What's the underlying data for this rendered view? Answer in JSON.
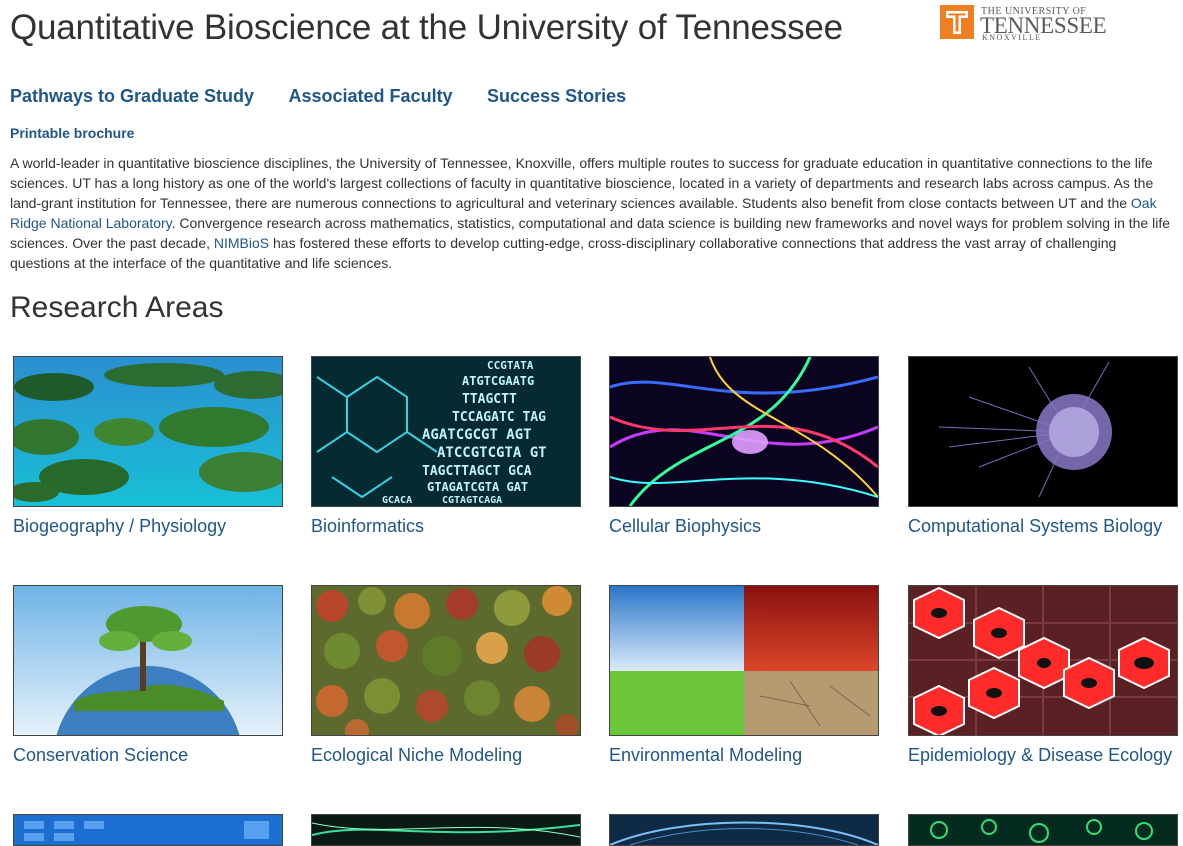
{
  "title": "Quantitative Bioscience at the University of Tennessee",
  "logo": {
    "line1": "THE UNIVERSITY OF",
    "line2": "TENNESSEE",
    "line3": "KNOXVILLE"
  },
  "nav": [
    {
      "label": "Pathways to Graduate Study"
    },
    {
      "label": "Associated Faculty"
    },
    {
      "label": "Success Stories"
    }
  ],
  "brochure_label": "Printable brochure",
  "intro": {
    "part1": "A world-leader in quantitative bioscience disciplines, the University of Tennessee, Knoxville, offers multiple routes to success for graduate education in quantitative connections to the life sciences. UT has a long history as one of the world's largest collections of faculty in quantitative bioscience, located in a variety of departments and research labs across campus. As the land-grant institution for Tennessee, there are numerous connections to agricultural and veterinary sciences available. Students also benefit from close contacts between UT and the ",
    "link1": "Oak Ridge National Laboratory",
    "part2": ". Convergence research across mathematics, statistics, computational and data science is building new frameworks and novel ways for problem solving in the life sciences. Over the past decade, ",
    "link2": "NIMBioS",
    "part3": " has fostered these efforts to develop cutting-edge, cross-disciplinary collaborative connections that address the vast array of challenging questions at the interface of the quantitative and life sciences."
  },
  "research_heading": "Research Areas",
  "research_areas": [
    {
      "label": "Biogeography / Physiology"
    },
    {
      "label": "Bioinformatics"
    },
    {
      "label": "Cellular Biophysics"
    },
    {
      "label": "Computational Systems Biology"
    },
    {
      "label": "Conservation Science"
    },
    {
      "label": "Ecological Niche Modeling"
    },
    {
      "label": "Environmental Modeling"
    },
    {
      "label": "Epidemiology & Disease Ecology"
    }
  ],
  "bioinformatics_seq": [
    "CCGTATA",
    "ATGTCGAATG",
    "TTAGCTT",
    "TCCAGATC TAG",
    "AGATCGCGT AGT",
    "ATCCGTCGTA GT",
    "TAGCTTAGCT GCA",
    "GTAGATCGTA GAT",
    "CGTAGTCAGA",
    "GCACA"
  ],
  "colors": {
    "link": "#1f5689",
    "ut_orange": "#f07f22"
  }
}
